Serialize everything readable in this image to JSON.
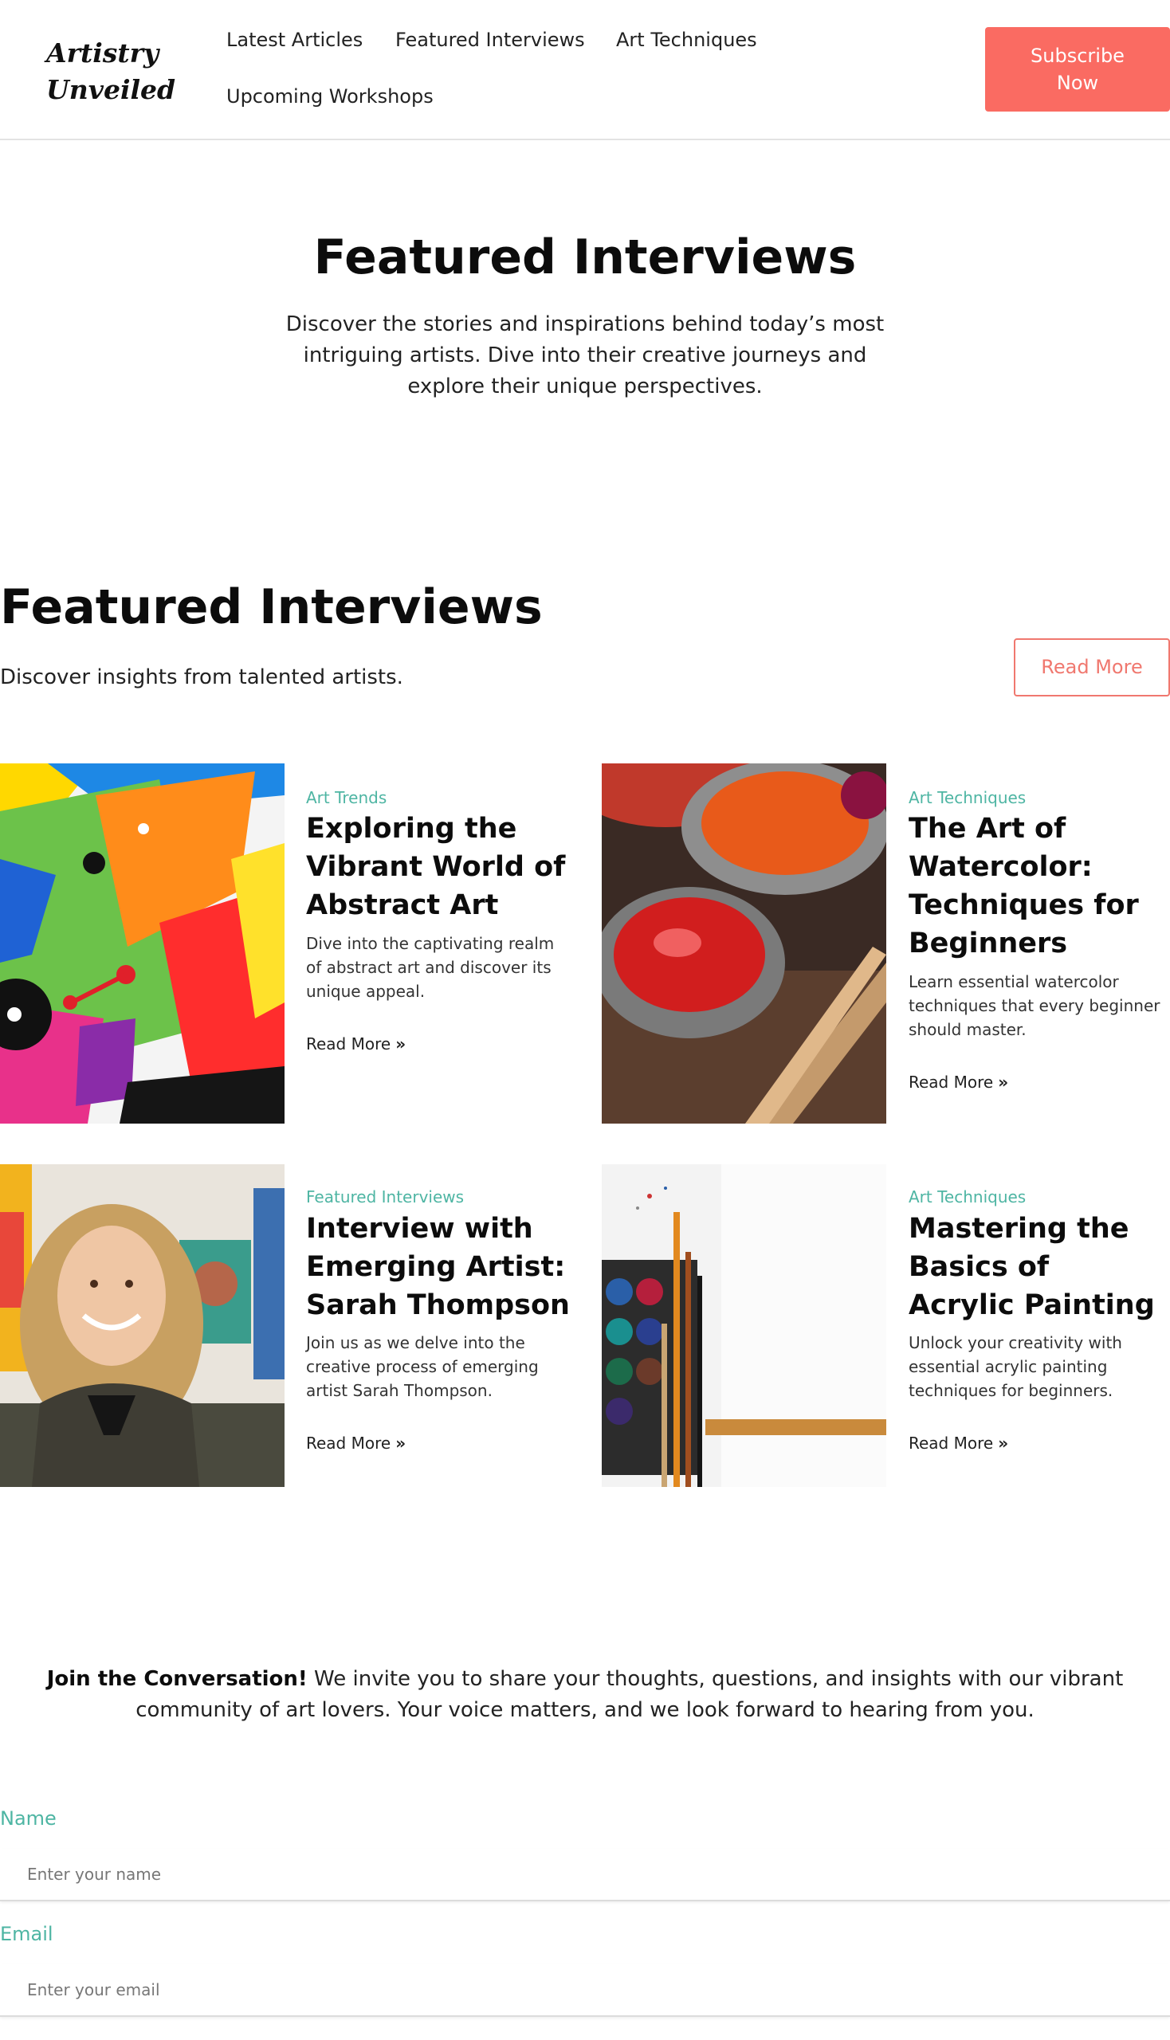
{
  "header": {
    "logo_line1": "Artistry",
    "logo_line2": "Unveiled",
    "nav": [
      "Latest Articles",
      "Featured Interviews",
      "Art Techniques",
      "Upcoming Workshops"
    ],
    "subscribe_line1": "Subscribe",
    "subscribe_line2": "Now"
  },
  "hero": {
    "title": "Featured Interviews",
    "subtitle": "Discover the stories and inspirations behind today’s most intriguing artists. Dive into their creative journeys and explore their unique perspectives."
  },
  "section": {
    "title": "Featured Interviews",
    "subtitle": "Discover insights from talented artists.",
    "read_more_label": "Read More"
  },
  "cards": [
    {
      "category": "Art Trends",
      "title": "Exploring the Vibrant World of Abstract Art",
      "description": "Dive into the captivating realm of abstract art and discover its unique appeal.",
      "link": "Read More",
      "image_icon": "abstract-painting-image"
    },
    {
      "category": "Art Techniques",
      "title": "The Art of Watercolor: Techniques for Beginners",
      "description": "Learn essential watercolor techniques that every beginner should master.",
      "link": "Read More",
      "image_icon": "paint-pots-image"
    },
    {
      "category": "Featured Interviews",
      "title": "Interview with Emerging Artist: Sarah Thompson",
      "description": "Join us as we delve into the creative process of emerging artist Sarah Thompson.",
      "link": "Read More",
      "image_icon": "artist-portrait-image"
    },
    {
      "category": "Art Techniques",
      "title": "Mastering the Basics of Acrylic Painting",
      "description": "Unlock your creativity with essential acrylic painting techniques for beginners.",
      "link": "Read More",
      "image_icon": "brushes-palette-image"
    }
  ],
  "conversation": {
    "lead": "Join the Conversation!",
    "text": " We invite you to share your thoughts, questions, and insights with our vibrant community of art lovers. Your voice matters, and we look forward to hearing from you."
  },
  "form": {
    "name_label": "Name",
    "name_placeholder": "Enter your name",
    "email_label": "Email",
    "email_placeholder": "Enter your email"
  },
  "colors": {
    "accent": "#fa6b62",
    "teal": "#4eb5a3"
  }
}
